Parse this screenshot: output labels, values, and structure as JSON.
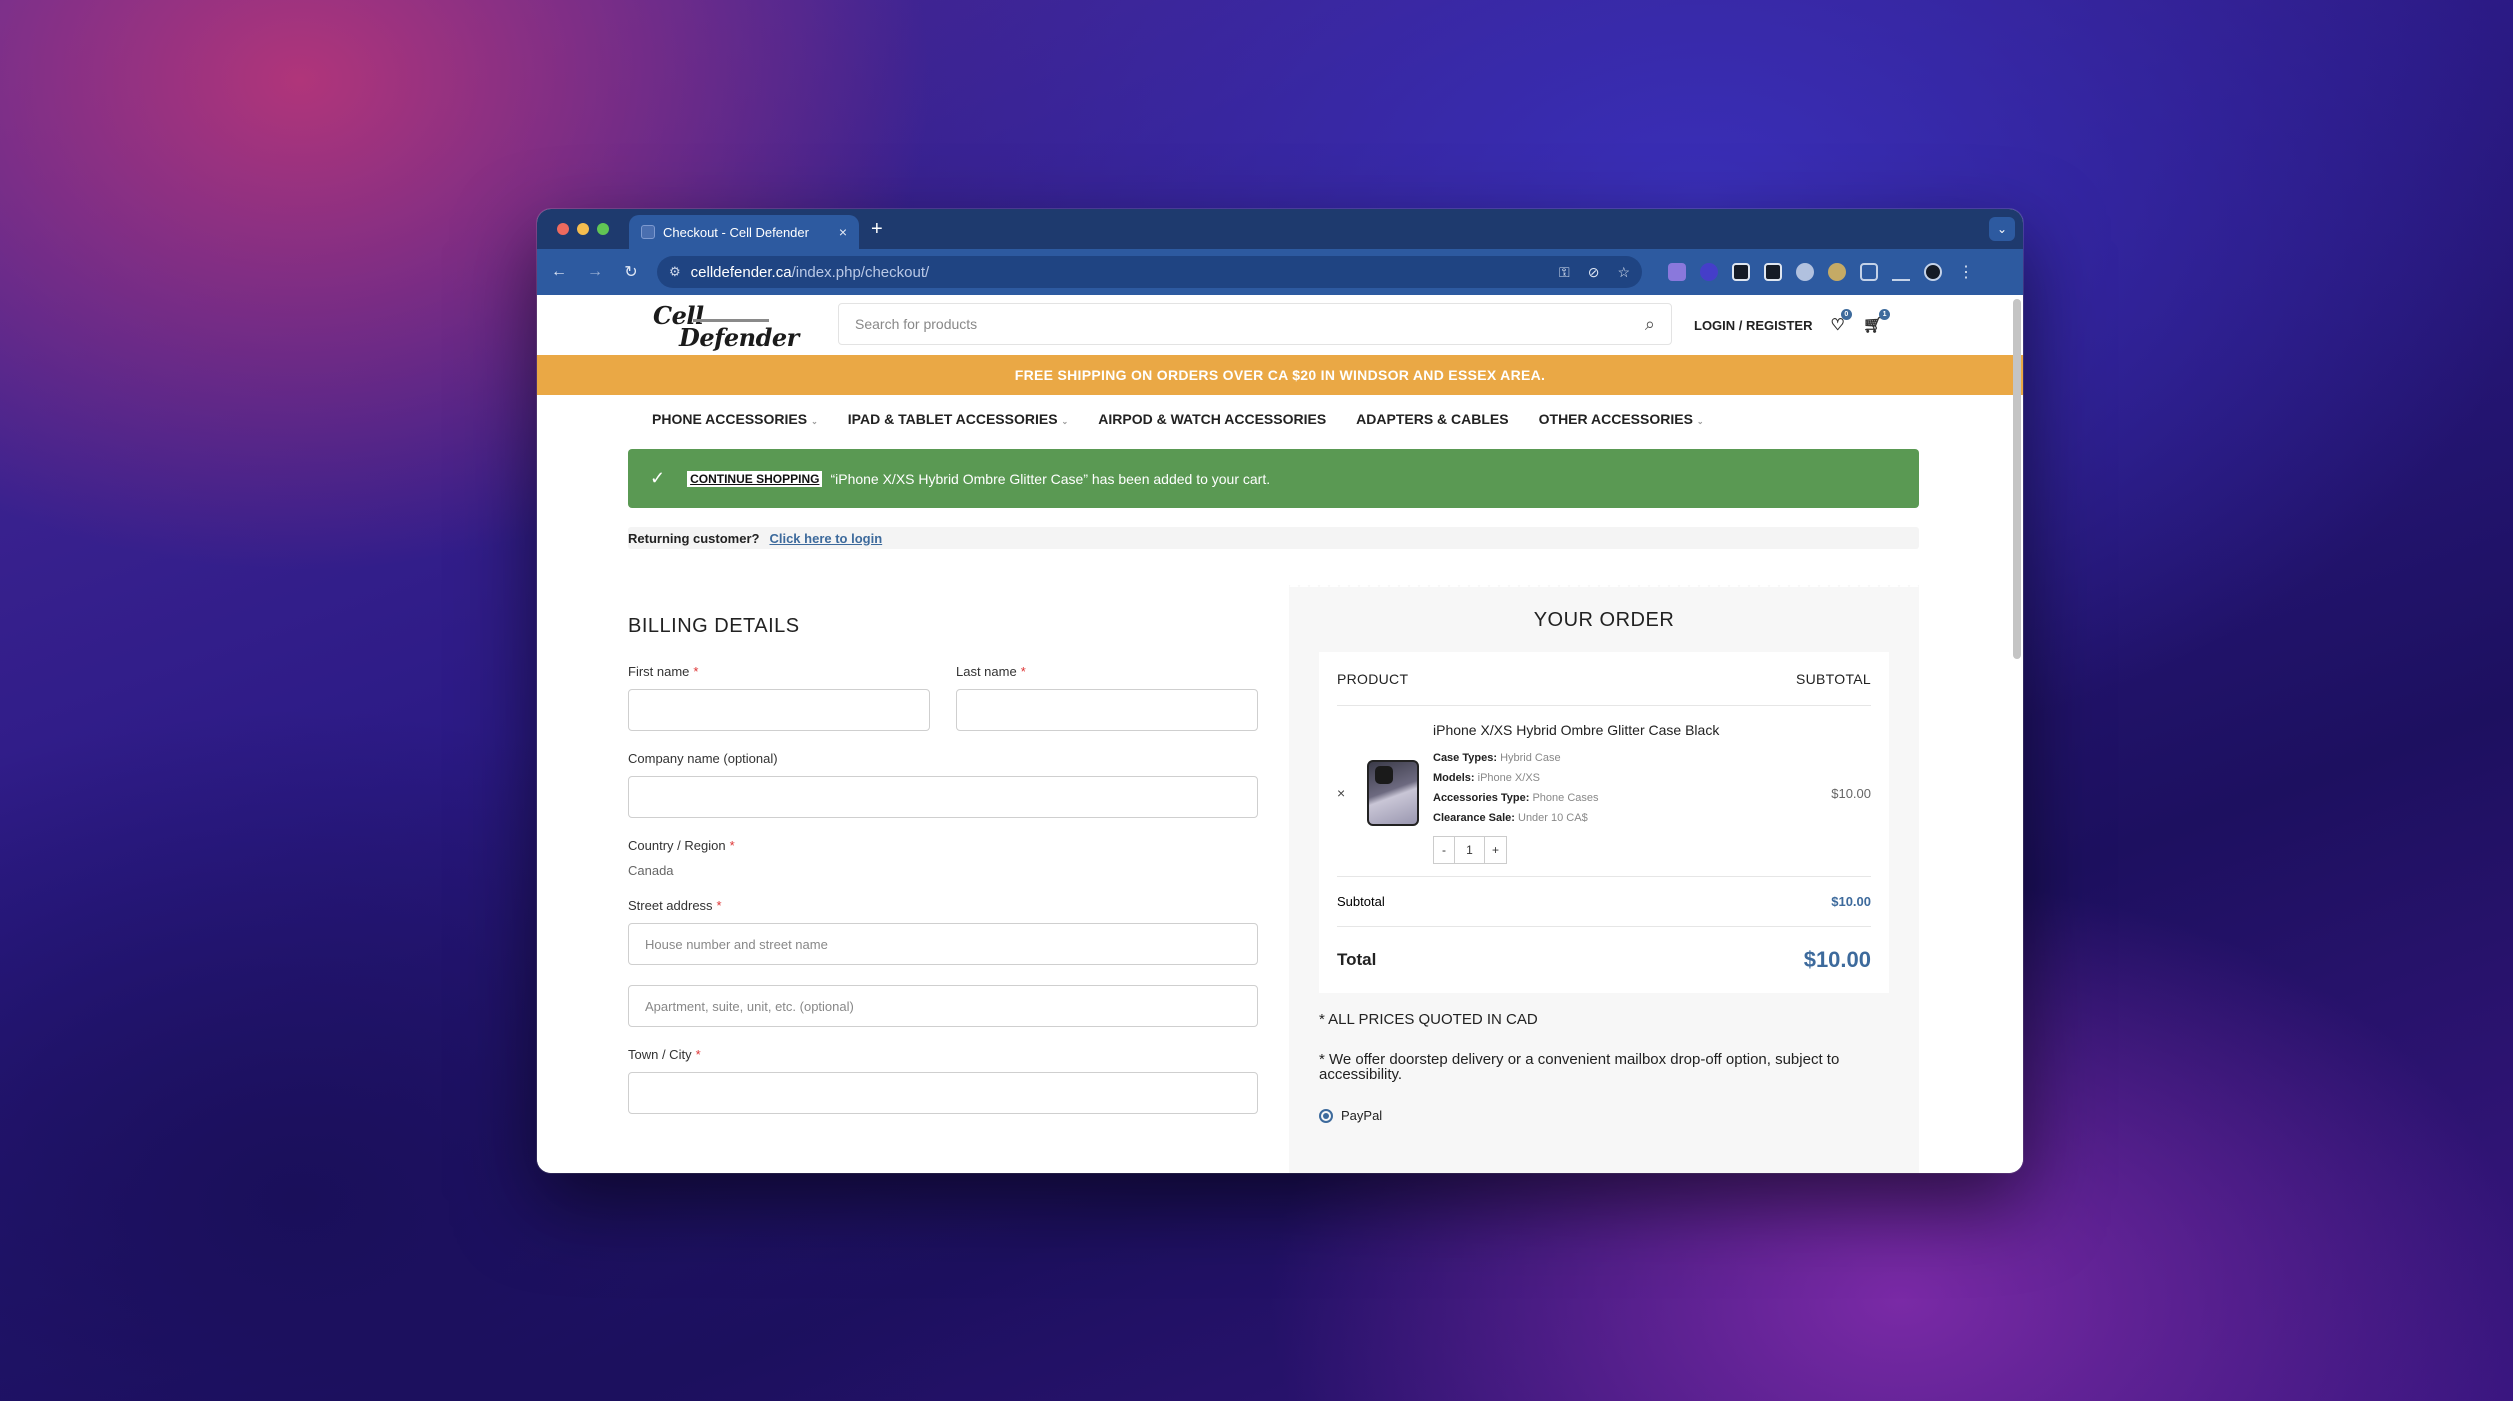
{
  "browser": {
    "tab_title": "Checkout - Cell Defender",
    "tab_close": "×",
    "new_tab": "+",
    "url_host": "celldefender.ca",
    "url_path": "/index.php/checkout/",
    "colors": {
      "tabbar": "#1e3a6e",
      "toolbar": "#2d5aa0"
    }
  },
  "header": {
    "logo_line1": "Cell",
    "logo_line2": "Defender",
    "search_placeholder": "Search for products",
    "login_label": "LOGIN / REGISTER",
    "wishlist_count": "0",
    "cart_count": "1"
  },
  "promo_banner": "FREE SHIPPING ON ORDERS OVER CA $20 IN WINDSOR AND ESSEX AREA.",
  "menu": {
    "items": [
      {
        "label": "PHONE ACCESSORIES",
        "has_dropdown": true
      },
      {
        "label": "IPAD & TABLET ACCESSORIES",
        "has_dropdown": true
      },
      {
        "label": "AIRPOD & WATCH ACCESSORIES",
        "has_dropdown": false
      },
      {
        "label": "ADAPTERS & CABLES",
        "has_dropdown": false
      },
      {
        "label": "OTHER ACCESSORIES",
        "has_dropdown": true
      }
    ]
  },
  "notice": {
    "button": "CONTINUE SHOPPING",
    "message": "“iPhone X/XS Hybrid Ombre Glitter Case” has been added to your cart.",
    "color": "#5a9953"
  },
  "returning": {
    "text": "Returning customer?",
    "link": "Click here to login"
  },
  "billing": {
    "title": "BILLING DETAILS",
    "first_name": "First name",
    "last_name": "Last name",
    "company": "Company name (optional)",
    "country_label": "Country / Region",
    "country_value": "Canada",
    "street_label": "Street address",
    "street_placeholder": "House number and street name",
    "apt_placeholder": "Apartment, suite, unit, etc. (optional)",
    "city_label": "Town / City",
    "required": "*"
  },
  "order": {
    "title": "YOUR ORDER",
    "col_product": "PRODUCT",
    "col_subtotal": "SUBTOTAL",
    "item": {
      "remove": "×",
      "name": "iPhone X/XS Hybrid Ombre Glitter Case Black",
      "attrs": [
        {
          "k": "Case Types:",
          "v": "Hybrid Case"
        },
        {
          "k": "Models:",
          "v": "iPhone X/XS"
        },
        {
          "k": "Accessories Type:",
          "v": "Phone Cases"
        },
        {
          "k": "Clearance Sale:",
          "v": "Under 10 CA$"
        }
      ],
      "qty_minus": "-",
      "qty": "1",
      "qty_plus": "+",
      "price": "$10.00"
    },
    "subtotal_label": "Subtotal",
    "subtotal_value": "$10.00",
    "total_label": "Total",
    "total_value": "$10.00",
    "note_cad": "* ALL PRICES QUOTED IN CAD",
    "note_delivery": "* We offer doorstep delivery or a convenient mailbox drop-off option, subject to accessibility.",
    "payment_option": "PayPal"
  }
}
